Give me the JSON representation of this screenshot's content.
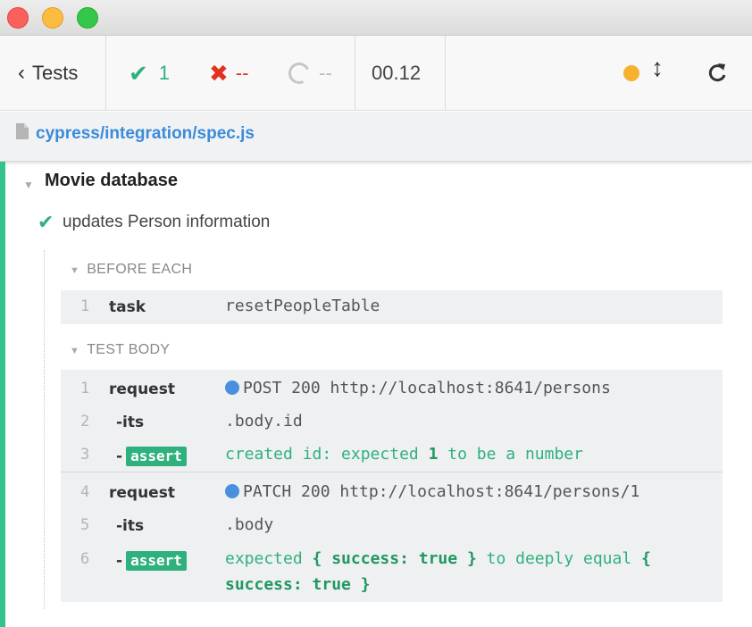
{
  "window": {
    "lights": [
      "close",
      "minimize",
      "maximize"
    ]
  },
  "stats": {
    "back_label": "Tests",
    "passed": "1",
    "failed": "--",
    "pending": "--",
    "duration": "00.12",
    "status_color": "#f6b22e"
  },
  "spec": {
    "path": "cypress/integration/spec.js"
  },
  "suite": {
    "title": "Movie database"
  },
  "test": {
    "title": "updates Person information"
  },
  "before_each": {
    "label": "BEFORE EACH",
    "commands": [
      {
        "num": "1",
        "name": "task",
        "message": "resetPeopleTable"
      }
    ]
  },
  "test_body": {
    "label": "TEST BODY",
    "commands": [
      {
        "num": "1",
        "name": "request",
        "message": "POST 200 http://localhost:8641/persons"
      },
      {
        "num": "2",
        "name": "-its",
        "message": ".body.id"
      },
      {
        "num": "3",
        "name": "-",
        "badge": "assert",
        "msg_a": "created id: expected ",
        "msg_b": "1",
        "msg_c": " to be a number"
      },
      {
        "num": "4",
        "name": "request",
        "message": "PATCH 200 http://localhost:8641/persons/1"
      },
      {
        "num": "5",
        "name": "-its",
        "message": ".body"
      },
      {
        "num": "6",
        "name": "-",
        "badge": "assert",
        "msg_a": "expected ",
        "msg_b": "{ success: true }",
        "msg_c": " to deeply equal ",
        "msg_d": "{",
        "msg_e": "success: true }"
      }
    ]
  },
  "colors": {
    "passed": "#2fb17d",
    "failed": "#e4301e",
    "link": "#3b8bd9",
    "request_dot": "#4a8fde"
  }
}
